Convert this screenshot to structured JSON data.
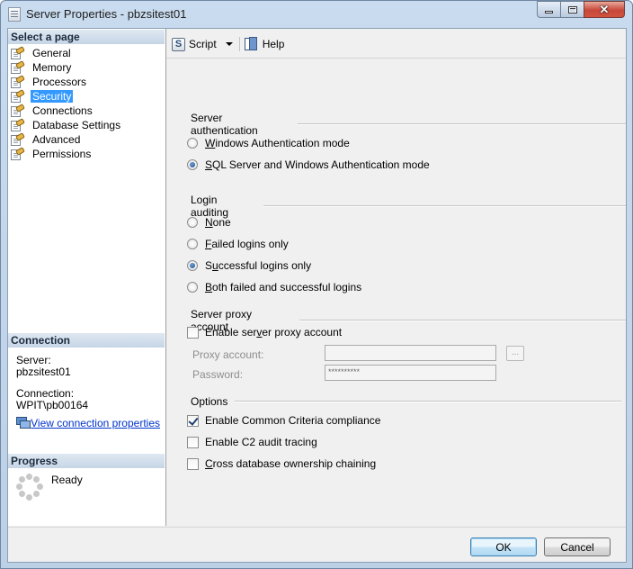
{
  "window": {
    "title": "Server Properties - pbzsitest01"
  },
  "left": {
    "select_page_header": "Select a page",
    "pages": [
      {
        "label": "General"
      },
      {
        "label": "Memory"
      },
      {
        "label": "Processors"
      },
      {
        "label": "Security",
        "selected": true
      },
      {
        "label": "Connections"
      },
      {
        "label": "Database Settings"
      },
      {
        "label": "Advanced"
      },
      {
        "label": "Permissions"
      }
    ],
    "connection": {
      "header": "Connection",
      "server_label": "Server:",
      "server_value": "pbzsitest01",
      "connection_label": "Connection:",
      "connection_value": "WPIT\\pb00164",
      "link_label": "View connection properties"
    },
    "progress": {
      "header": "Progress",
      "status": "Ready"
    }
  },
  "toolbar": {
    "script_label": "Script",
    "help_label": "Help"
  },
  "security": {
    "server_auth": {
      "title": "Server authentication",
      "options": [
        {
          "label": "Windows Authentication mode",
          "accel": "W",
          "selected": false
        },
        {
          "label": "SQL Server and Windows Authentication mode",
          "accel": "S",
          "selected": true
        }
      ]
    },
    "login_auditing": {
      "title": "Login auditing",
      "options": [
        {
          "label": "None",
          "accel": "N",
          "selected": false
        },
        {
          "label": "Failed logins only",
          "accel": "F",
          "selected": false
        },
        {
          "label": "Successful logins only",
          "accel": "u",
          "selected": true
        },
        {
          "label": "Both failed and successful logins",
          "accel": "B",
          "selected": false
        }
      ]
    },
    "proxy": {
      "title": "Server proxy account",
      "enable_label": "Enable server proxy account",
      "enable_checked": false,
      "proxy_account_label": "Proxy account:",
      "proxy_account_value": "",
      "password_label": "Password:",
      "password_value": "**********",
      "browse_label": "..."
    },
    "options": {
      "title": "Options",
      "items": [
        {
          "label": "Enable Common Criteria compliance",
          "checked": true
        },
        {
          "label": "Enable C2 audit tracing",
          "checked": false
        },
        {
          "label": "Cross database ownership chaining",
          "checked": false
        }
      ]
    }
  },
  "footer": {
    "ok_label": "OK",
    "cancel_label": "Cancel"
  },
  "colors": {
    "selection": "#3399ff",
    "link": "#0033cc",
    "section_header": "#c6d5e6"
  }
}
